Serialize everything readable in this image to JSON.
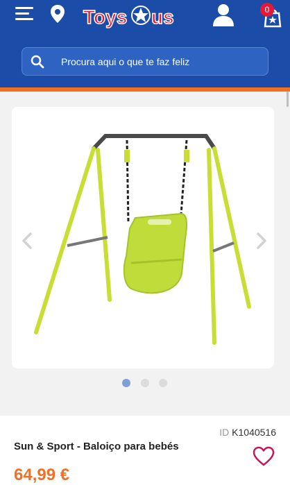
{
  "header": {
    "logo_text": "ToysRus",
    "cart_count": "0",
    "colors": {
      "header_bg": "#1b4ca8",
      "accent_bar": "#f36f21",
      "badge": "#e3193b"
    },
    "icons": [
      "menu-icon",
      "location-pin-icon",
      "user-icon",
      "cart-icon"
    ]
  },
  "search": {
    "placeholder": "Procura aqui o que te faz feliz",
    "icon": "search-icon"
  },
  "gallery": {
    "image_alt": "Baloiço para bebés",
    "total_images": 3,
    "active_index": 0,
    "icons": [
      "chevron-left-icon",
      "chevron-right-icon"
    ]
  },
  "product": {
    "id_label": "ID",
    "id_value": "K1040516",
    "title": "Sun & Sport - Baloiço para bebés",
    "price": "64,99 €",
    "price_color": "#f36f21",
    "favorite_icon": "heart-icon"
  }
}
